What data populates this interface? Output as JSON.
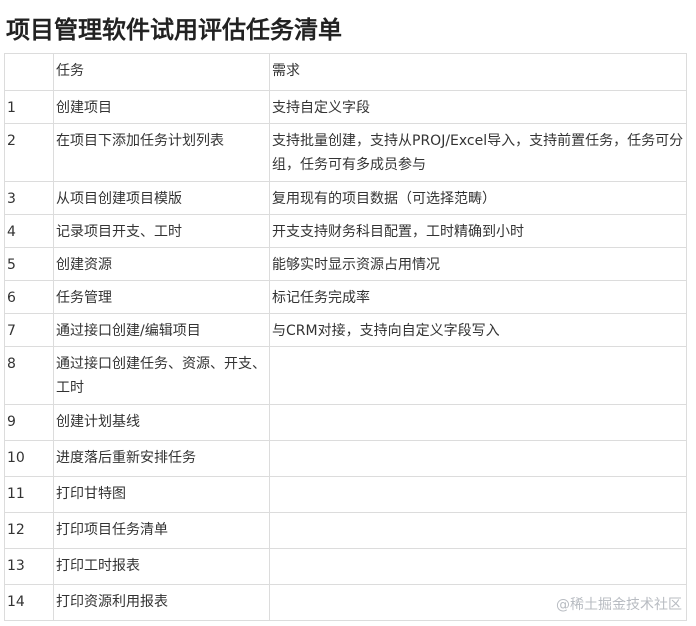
{
  "title": "项目管理软件试用评估任务清单",
  "table": {
    "header": {
      "num": "",
      "task": "任务",
      "requirement": "需求"
    },
    "rows": [
      {
        "num": "1",
        "task": "创建项目",
        "requirement": "支持自定义字段"
      },
      {
        "num": "2",
        "task": "在项目下添加任务计划列表",
        "requirement": "支持批量创建，支持从PROJ/Excel导入，支持前置任务，任务可分组，任务可有多成员参与"
      },
      {
        "num": "3",
        "task": "从项目创建项目模版",
        "requirement": "复用现有的项目数据（可选择范畴）"
      },
      {
        "num": "4",
        "task": "记录项目开支、工时",
        "requirement": "开支支持财务科目配置，工时精确到小时"
      },
      {
        "num": "5",
        "task": "创建资源",
        "requirement": "能够实时显示资源占用情况"
      },
      {
        "num": "6",
        "task": "任务管理",
        "requirement": "标记任务完成率"
      },
      {
        "num": "7",
        "task": "通过接口创建/编辑项目",
        "requirement": "与CRM对接，支持向自定义字段写入"
      },
      {
        "num": "8",
        "task": "通过接口创建任务、资源、开支、工时",
        "requirement": ""
      },
      {
        "num": "9",
        "task": "创建计划基线",
        "requirement": ""
      },
      {
        "num": "10",
        "task": "进度落后重新安排任务",
        "requirement": ""
      },
      {
        "num": "11",
        "task": "打印甘特图",
        "requirement": ""
      },
      {
        "num": "12",
        "task": "打印项目任务清单",
        "requirement": ""
      },
      {
        "num": "13",
        "task": "打印工时报表",
        "requirement": ""
      },
      {
        "num": "14",
        "task": "打印资源利用报表",
        "requirement": ""
      }
    ]
  },
  "watermark": "@稀土掘金技术社区"
}
